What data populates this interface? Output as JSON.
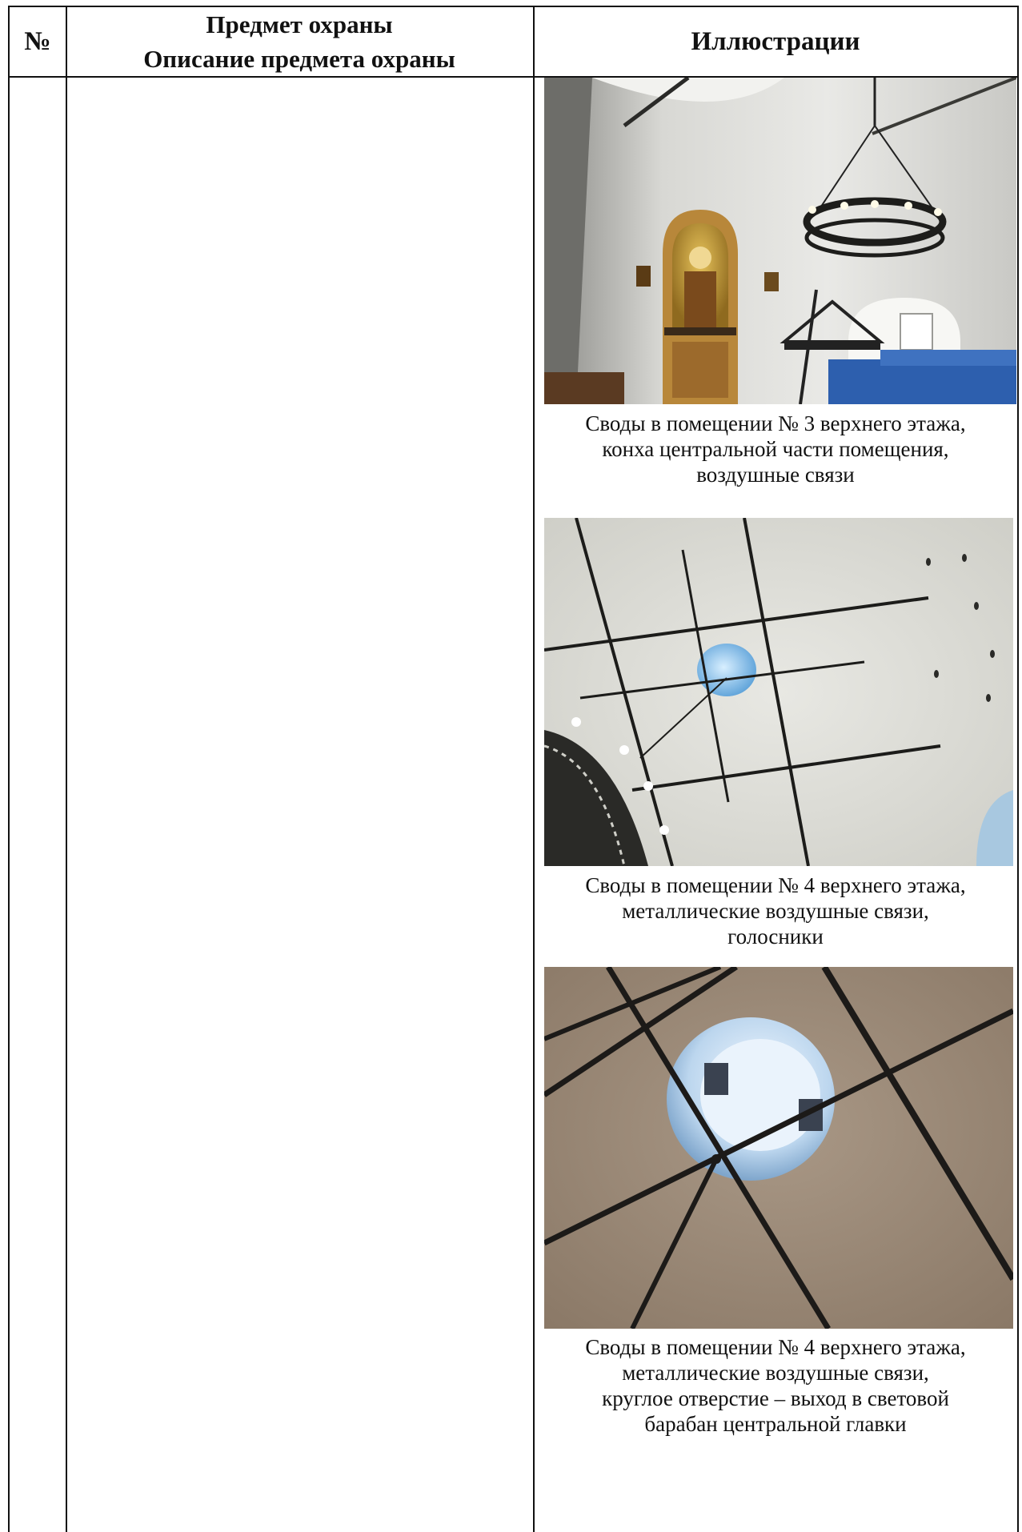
{
  "header": {
    "num": "№",
    "subject_line1": "Предмет охраны",
    "subject_line2": "Описание предмета охраны",
    "illustrations": "Иллюстрации"
  },
  "illustrations": [
    {
      "caption_lines": [
        "Своды в помещении № 3 верхнего этажа,",
        "конха центральной части помещения,",
        "воздушные связи"
      ]
    },
    {
      "caption_lines": [
        "Своды в помещении № 4 верхнего этажа,",
        "металлические воздушные связи,",
        "голосники"
      ]
    },
    {
      "caption_lines": [
        "Своды в помещении № 4 верхнего этажа,",
        "металлические воздушные связи,",
        "круглое отверстие – выход в световой",
        "барабан центральной главки"
      ]
    }
  ]
}
